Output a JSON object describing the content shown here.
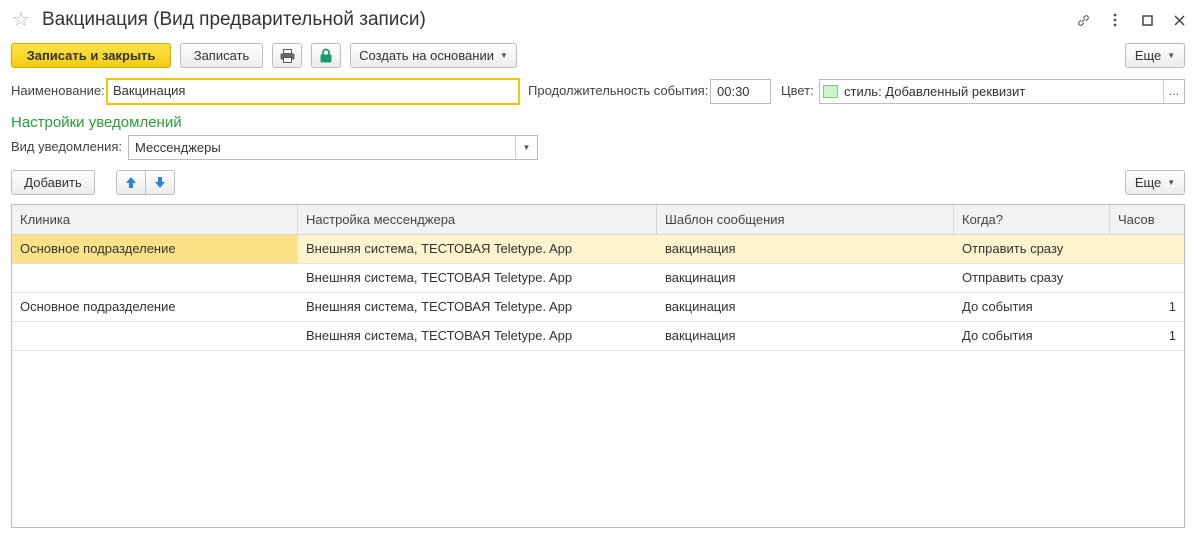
{
  "window": {
    "title": "Вакцинация (Вид предварительной записи)",
    "icons": [
      "star-icon",
      "link-icon",
      "more-vertical-icon",
      "maximize-icon",
      "close-icon"
    ]
  },
  "toolbar": {
    "save_close_label": "Записать и закрыть",
    "save_label": "Записать",
    "create_based_label": "Создать на основании",
    "more_label": "Еще"
  },
  "form": {
    "name_label": "Наименование:",
    "name_value": "Вакцинация",
    "duration_label": "Продолжительность события:",
    "duration_value": "00:30",
    "color_label": "Цвет:",
    "color_value": "стиль: Добавленный реквизит",
    "color_swatch": "#c9f5c9",
    "ellipsis": "..."
  },
  "notifications": {
    "section_title": "Настройки уведомлений",
    "type_label": "Вид уведомления:",
    "type_value": "Мессенджеры",
    "add_label": "Добавить",
    "more_label": "Еще"
  },
  "table": {
    "columns": [
      "Клиника",
      "Настройка мессенджера",
      "Шаблон сообщения",
      "Когда?",
      "Часов"
    ],
    "rows": [
      {
        "clinic": "Основное подразделение",
        "messenger": "Внешняя система, ТЕСТОВАЯ Teletype. App",
        "template": "вакцинация",
        "when": "Отправить сразу",
        "hours": ""
      },
      {
        "clinic": "",
        "messenger": "Внешняя система, ТЕСТОВАЯ Teletype. App",
        "template": "вакцинация",
        "when": "Отправить сразу",
        "hours": ""
      },
      {
        "clinic": "Основное подразделение",
        "messenger": "Внешняя система, ТЕСТОВАЯ Teletype. App",
        "template": "вакцинация",
        "when": "До события",
        "hours": "1"
      },
      {
        "clinic": "",
        "messenger": "Внешняя система, ТЕСТОВАЯ Teletype. App",
        "template": "вакцинация",
        "when": "До события",
        "hours": "1"
      }
    ]
  },
  "colors": {
    "accent_yellow": "#f4cc10",
    "section_green": "#2a9d3a",
    "selected_row": "#fdf3cd"
  }
}
